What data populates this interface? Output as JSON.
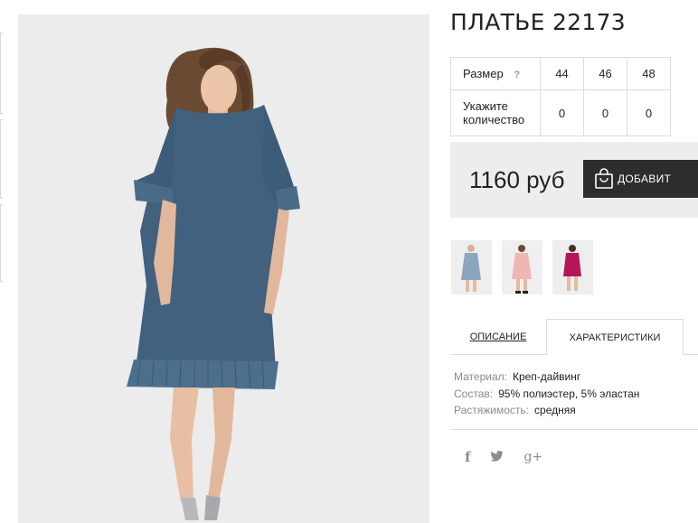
{
  "product": {
    "title": "ПЛАТЬЕ 22173",
    "main_image": "model-in-blue-dress"
  },
  "size_table": {
    "size_label": "Размер",
    "help_symbol": "?",
    "sizes": [
      "44",
      "46",
      "48"
    ],
    "quantity_label": "Укажите количество",
    "quantities": [
      "0",
      "0",
      "0"
    ]
  },
  "price": {
    "amount": "1160 руб",
    "buy_label": "ДОБАВИТ",
    "buy_icon": "shopping-bag-icon"
  },
  "color_variants": [
    {
      "name": "blue",
      "color": "#5b7fa0"
    },
    {
      "name": "pink",
      "color": "#f0b6b3"
    },
    {
      "name": "magenta",
      "color": "#b5165a"
    }
  ],
  "tabs": {
    "description": "ОПИСАНИЕ",
    "characteristics": "ХАРАКТЕРИСТИКИ",
    "active": "characteristics"
  },
  "specs": [
    {
      "key": "Материал:",
      "value": "Креп-дайвинг"
    },
    {
      "key": "Состав:",
      "value": "95% полиэстер, 5% эластан"
    },
    {
      "key": "Растяжимость:",
      "value": "средняя"
    }
  ],
  "social": {
    "facebook": "f",
    "twitter": "twitter-icon",
    "google_plus": "g+"
  },
  "colors": {
    "dress": "#41617e",
    "button_bg": "#2d2d2d",
    "price_bg": "#ededed"
  }
}
